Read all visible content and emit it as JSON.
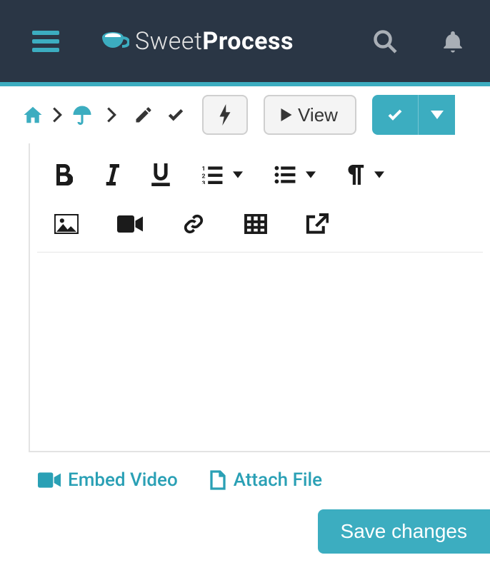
{
  "nav": {
    "brand_thin": "Sweet",
    "brand_bold": "Process"
  },
  "subbar": {
    "view_label": "View"
  },
  "footer": {
    "embed_video": "Embed Video",
    "attach_file": "Attach File",
    "save": "Save changes"
  }
}
